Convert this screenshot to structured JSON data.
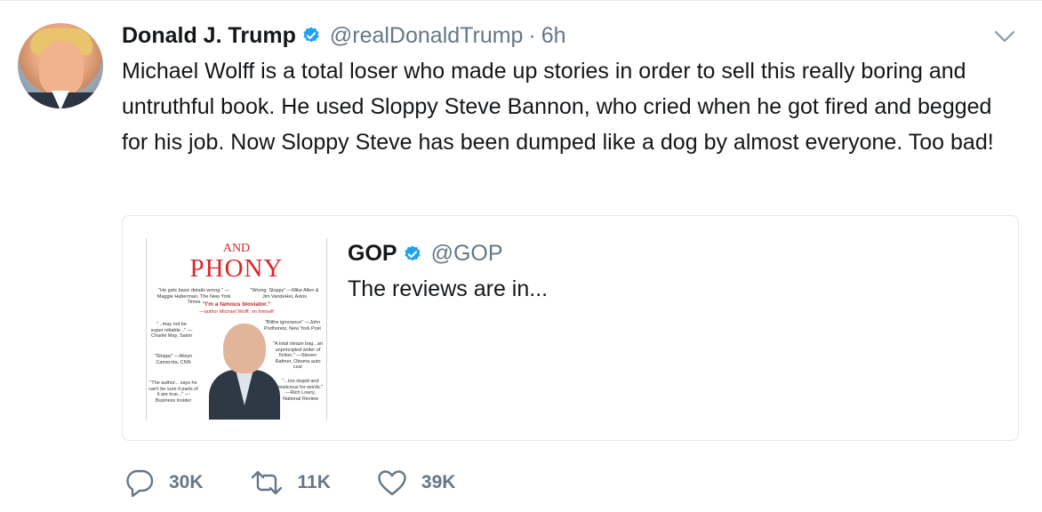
{
  "tweet": {
    "author_name": "Donald J. Trump",
    "author_handle": "@realDonaldTrump",
    "separator": "·",
    "time": "6h",
    "text": "Michael Wolff is a total loser who made up stories in order to sell this really boring and untruthful book. He used Sloppy Steve Bannon, who cried when he got fired and begged for his job. Now Sloppy Steve has been dumped like a dog by almost everyone. Too bad!"
  },
  "quoted_tweet": {
    "author_name": "GOP",
    "author_handle": "@GOP",
    "text": "The reviews are in...",
    "image": {
      "title_top": "AND",
      "title_main": "PHONY",
      "blurbs": {
        "b1": "\"He gets basic details wrong.\" —Maggie Haberman, The New York Times",
        "b2": "\"Wrong. Sloppy\" —Mike Allen & Jim VandeHei, Axios",
        "b3": "\"I'm a famous bloviator.\"",
        "b3src": "—author Michael Wolff, on himself",
        "b4": "\"...may not be super reliable...\" —Charlie May, Salon",
        "b5": "\"Blithe ignorance\" —John Podhoretz, New York Post",
        "b6": "\"A total sleaze bag...an unprincipled writer of fiction.\" —Steven Rattner, Obama auto czar",
        "b7": "\"Sloppy\" —Alisyn Camerota, CNN",
        "b8": "\"The author... says he can't be sure if parts of it are true...\" —Business Insider",
        "b9": "\"...too stupid and malicious for words.\" —Rich Lowry, National Review"
      }
    }
  },
  "actions": {
    "reply_count": "30K",
    "retweet_count": "11K",
    "like_count": "39K"
  },
  "colors": {
    "verified_blue": "#1da1f2",
    "secondary_text": "#657786",
    "book_red": "#d8262b"
  },
  "icons": {
    "verified": "verified-badge-icon",
    "menu": "chevron-down-icon",
    "reply": "reply-icon",
    "retweet": "retweet-icon",
    "like": "heart-icon"
  }
}
